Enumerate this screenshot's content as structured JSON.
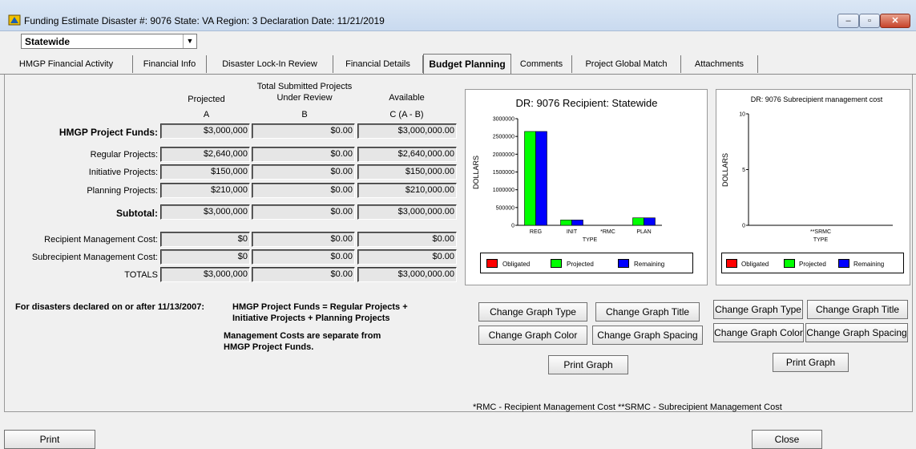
{
  "window": {
    "title": "Funding Estimate  Disaster #: 9076  State: VA  Region: 3   Declaration Date: 11/21/2019",
    "minimize": "–",
    "maximize": "▫",
    "close": "✕"
  },
  "selector": {
    "value": "Statewide",
    "arrow": "▼"
  },
  "tabs": [
    {
      "label": "HMGP Financial Activity"
    },
    {
      "label": "Financial Info"
    },
    {
      "label": "Disaster Lock-In Review"
    },
    {
      "label": "Financial Details"
    },
    {
      "label": "Budget Planning"
    },
    {
      "label": "Comments"
    },
    {
      "label": "Project Global Match"
    },
    {
      "label": "Attachments"
    }
  ],
  "table": {
    "col_a": {
      "title": "Projected",
      "letter": "A"
    },
    "col_b": {
      "title_1": "Total Submitted Projects",
      "title_2": "Under Review",
      "letter": "B"
    },
    "col_c": {
      "title": "Available",
      "letter": "C  (A - B)"
    },
    "rows": [
      {
        "label": "HMGP Project Funds:",
        "a": "$3,000,000",
        "b": "$0.00",
        "c": "$3,000,000.00"
      },
      {
        "label": "Regular Projects:",
        "a": "$2,640,000",
        "b": "$0.00",
        "c": "$2,640,000.00"
      },
      {
        "label": "Initiative Projects:",
        "a": "$150,000",
        "b": "$0.00",
        "c": "$150,000.00"
      },
      {
        "label": "Planning Projects:",
        "a": "$210,000",
        "b": "$0.00",
        "c": "$210,000.00"
      },
      {
        "label": "Subtotal:",
        "a": "$3,000,000",
        "b": "$0.00",
        "c": "$3,000,000.00"
      },
      {
        "label": "Recipient Management Cost:",
        "a": "$0",
        "b": "$0.00",
        "c": "$0.00"
      },
      {
        "label": "Subrecipient Management Cost:",
        "a": "$0",
        "b": "$0.00",
        "c": "$0.00"
      },
      {
        "label": "TOTALS",
        "a": "$3,000,000",
        "b": "$0.00",
        "c": "$3,000,000.00"
      }
    ]
  },
  "notes": {
    "line1_prefix": "For disasters declared on or after 11/13/2007:",
    "line1_rest": "HMGP Project Funds = Regular Projects +",
    "line2": "Initiative Projects + Planning Projects",
    "line3": "Management Costs are separate from",
    "line4": "HMGP Project Funds."
  },
  "colors": {
    "obligated": "#ff0000",
    "projected": "#00ff00",
    "remaining": "#0000ff"
  },
  "chart_data": [
    {
      "type": "bar",
      "title": "DR: 9076 Recipient: Statewide",
      "xlabel": "TYPE",
      "ylabel": "DOLLARS",
      "categories": [
        "REG",
        "INIT",
        "*RMC",
        "PLAN"
      ],
      "yticks": [
        "0",
        "500000",
        "1000000",
        "1500000",
        "2000000",
        "2500000",
        "3000000"
      ],
      "ylim": [
        0,
        3000000
      ],
      "series": [
        {
          "name": "Obligated",
          "values": [
            0,
            0,
            0,
            0
          ]
        },
        {
          "name": "Projected",
          "values": [
            2640000,
            150000,
            0,
            210000
          ]
        },
        {
          "name": "Remaining",
          "values": [
            2640000,
            150000,
            0,
            210000
          ]
        }
      ],
      "legend": "bottom"
    },
    {
      "type": "bar",
      "title": "DR: 9076 Subrecipient management cost",
      "xlabel": "TYPE",
      "ylabel": "DOLLARS",
      "categories": [
        "**SRMC"
      ],
      "yticks": [
        "0",
        "5",
        "10"
      ],
      "ylim": [
        0,
        10
      ],
      "series": [
        {
          "name": "Obligated",
          "values": [
            0
          ]
        },
        {
          "name": "Projected",
          "values": [
            0
          ]
        },
        {
          "name": "Remaining",
          "values": [
            0
          ]
        }
      ],
      "legend": "bottom"
    }
  ],
  "buttons": {
    "change_type": "Change Graph Type",
    "change_title": "Change Graph Title",
    "change_color": "Change Graph Color",
    "change_spacing": "Change Graph Spacing",
    "print_graph": "Print Graph",
    "print": "Print",
    "close": "Close"
  },
  "footnote": "*RMC - Recipient Management Cost     **SRMC - Subrecipient Management Cost"
}
